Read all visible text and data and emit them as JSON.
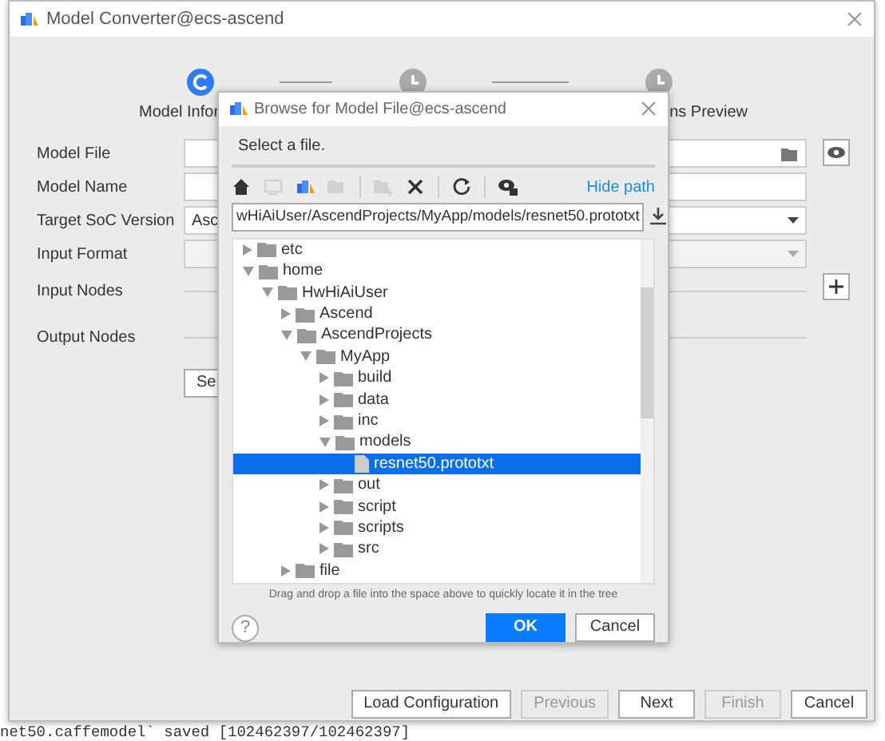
{
  "window": {
    "title": "Model Converter@ecs-ascend"
  },
  "steps": [
    {
      "label": "Model Infor",
      "active": true
    },
    {
      "active": false
    },
    {
      "label": "ns  Preview",
      "active": false
    }
  ],
  "form": {
    "fields": [
      {
        "label": "Model File",
        "kind": "file"
      },
      {
        "label": "Model Name",
        "kind": "text"
      },
      {
        "label": "Target SoC Version",
        "kind": "select",
        "value": "Asc",
        "disabled": false
      },
      {
        "label": "Input Format",
        "kind": "select",
        "disabled": true
      },
      {
        "label": "Input Nodes",
        "kind": "nodes"
      },
      {
        "label": "Output Nodes",
        "kind": "nodes"
      }
    ],
    "select_button": "Se"
  },
  "footer_buttons": [
    {
      "label": "Load Configuration",
      "disabled": false
    },
    {
      "label": "Previous",
      "disabled": true
    },
    {
      "label": "Next",
      "disabled": false
    },
    {
      "label": "Finish",
      "disabled": true
    },
    {
      "label": "Cancel",
      "disabled": false
    }
  ],
  "dialog": {
    "title": "Browse for Model File@ecs-ascend",
    "prompt": "Select a file.",
    "toolbar": [
      {
        "kind": "home",
        "disabled": false
      },
      {
        "kind": "computer",
        "disabled": true
      },
      {
        "kind": "cloud",
        "disabled": false
      },
      {
        "kind": "folder-grid",
        "disabled": true
      },
      {
        "kind": "new-folder",
        "disabled": true
      },
      {
        "kind": "delete",
        "disabled": false
      },
      {
        "kind": "refresh",
        "disabled": false
      },
      {
        "kind": "hidden-files",
        "disabled": false
      }
    ],
    "hide_path": "Hide path",
    "path": "ᴡHiAiUser/AscendProjects/MyApp/models/resnet50.prototxt",
    "tree": [
      {
        "name": "etc",
        "kind": "folder",
        "expanded": false,
        "selected": false
      },
      {
        "name": "home",
        "kind": "folder",
        "expanded": true,
        "selected": false,
        "children": [
          {
            "name": "HwHiAiUser",
            "kind": "folder",
            "expanded": true,
            "selected": false,
            "children": [
              {
                "name": "Ascend",
                "kind": "folder",
                "expanded": false,
                "selected": false
              },
              {
                "name": "AscendProjects",
                "kind": "folder",
                "expanded": true,
                "selected": false,
                "children": [
                  {
                    "name": "MyApp",
                    "kind": "folder",
                    "expanded": true,
                    "selected": false,
                    "children": [
                      {
                        "name": "build",
                        "kind": "folder",
                        "expanded": false,
                        "selected": false
                      },
                      {
                        "name": "data",
                        "kind": "folder",
                        "expanded": false,
                        "selected": false
                      },
                      {
                        "name": "inc",
                        "kind": "folder",
                        "expanded": false,
                        "selected": false
                      },
                      {
                        "name": "models",
                        "kind": "folder",
                        "expanded": true,
                        "selected": false,
                        "children": [
                          {
                            "name": "resnet50.prototxt",
                            "kind": "file",
                            "selected": true
                          }
                        ]
                      },
                      {
                        "name": "out",
                        "kind": "folder",
                        "expanded": false,
                        "selected": false
                      },
                      {
                        "name": "script",
                        "kind": "folder",
                        "expanded": false,
                        "selected": false
                      },
                      {
                        "name": "scripts",
                        "kind": "folder",
                        "expanded": false,
                        "selected": false
                      },
                      {
                        "name": "src",
                        "kind": "folder",
                        "expanded": false,
                        "selected": false
                      }
                    ]
                  }
                ]
              },
              {
                "name": "file",
                "kind": "folder",
                "expanded": false,
                "selected": false
              }
            ]
          }
        ]
      }
    ],
    "hint": "Drag and drop a file into the space above to quickly locate it in the tree",
    "help": "?",
    "buttons": [
      {
        "label": "OK",
        "primary": true
      },
      {
        "label": "Cancel",
        "primary": false
      }
    ]
  },
  "console": "net50.caffemodel` saved [102462397/102462397]"
}
